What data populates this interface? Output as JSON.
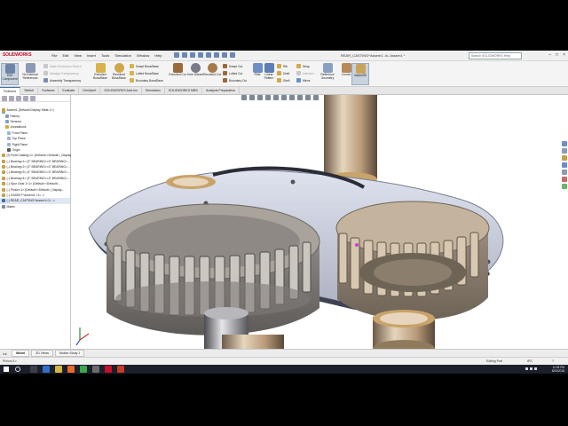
{
  "app": {
    "logo": "SOLIDWORKS",
    "document_title": "REAR_CASTING^Assem1 -in- Assem1 *",
    "search_placeholder": "Search SOLIDWORKS Help",
    "window_controls": [
      "–",
      "□",
      "×"
    ]
  },
  "menu": [
    "File",
    "Edit",
    "View",
    "Insert",
    "Tools",
    "Simulation",
    "Window",
    "Help"
  ],
  "commands": {
    "edit_component": "Edit Component",
    "no_external_references": "No External References",
    "make_dimension_sketch": "Make Dimension Sketch",
    "manage_transparency": "Manage Transparency",
    "assembly_transparency": "Assembly Transparency",
    "extruded_boss": "Extruded Boss/Base",
    "revolved_boss": "Revolved Boss/Base",
    "swept_boss": "Swept Boss/Base",
    "lofted_boss": "Lofted Boss/Base",
    "boundary_boss": "Boundary Boss/Base",
    "extruded_cut": "Extruded Cut",
    "hole_wizard": "Hole Wizard",
    "revolved_cut": "Revolved Cut",
    "swept_cut": "Swept Cut",
    "lofted_cut": "Lofted Cut",
    "boundary_cut": "Boundary Cut",
    "fillet": "Fillet",
    "linear_pattern": "Linear Pattern",
    "rib": "Rib",
    "draft": "Draft",
    "shell": "Shell",
    "wrap": "Wrap",
    "intersect": "Intersect",
    "mirror": "Mirror",
    "reference_geometry": "Reference Geometry",
    "curves": "Curves",
    "instant3d": "Instant3D"
  },
  "tabs": [
    "Features",
    "Sketch",
    "Surfaces",
    "Evaluate",
    "DimXpert",
    "SOLIDWORKS Add-Ins",
    "Simulation",
    "SOLIDWORKS MBD",
    "Analysis Preparation"
  ],
  "tree": {
    "root": "Assem1 (Default<Display State-1>)",
    "items": [
      "History",
      "Sensors",
      "Annotations",
      "Front Plane",
      "Top Plane",
      "Right Plane",
      "Origin",
      "(f) Front Casting<1> (Default<<Default>_Display...",
      "(-) Bearing<1> (3\" BEARING<<3\" BEARING>...",
      "(-) Bearing<2> (3\" BEARING<<3\" BEARING>...",
      "(-) Bearing<3> (3\" BEARING<<3\" BEARING>...",
      "(-) Bearing<4> (3\" BEARING<<3\" BEARING>...",
      "(-) Spur Gear 1<1> (Default<<Default>...",
      "(-) Pinion<1> (Default<<Default>_Display...",
      "(-) GASKET^Assem1 <1> ->",
      "(-) REAR_CASTING^Assem1<1> ->",
      "Mates"
    ]
  },
  "bottom_tabs": [
    "Model",
    "3D Views",
    "Motion Study 1"
  ],
  "status": {
    "left": "Pinion<1>",
    "mode": "Editing Part",
    "units": "IPS",
    "help": "?"
  },
  "taskbar": {
    "time": "11:28 PM",
    "date": "8/24/2018"
  },
  "colors": {
    "brand": "#c8102e",
    "accent": "#3a6fb0",
    "metal_gear": "#a99c8c",
    "bronze": "#c9a36a",
    "gasket": "#c8cdd9"
  }
}
